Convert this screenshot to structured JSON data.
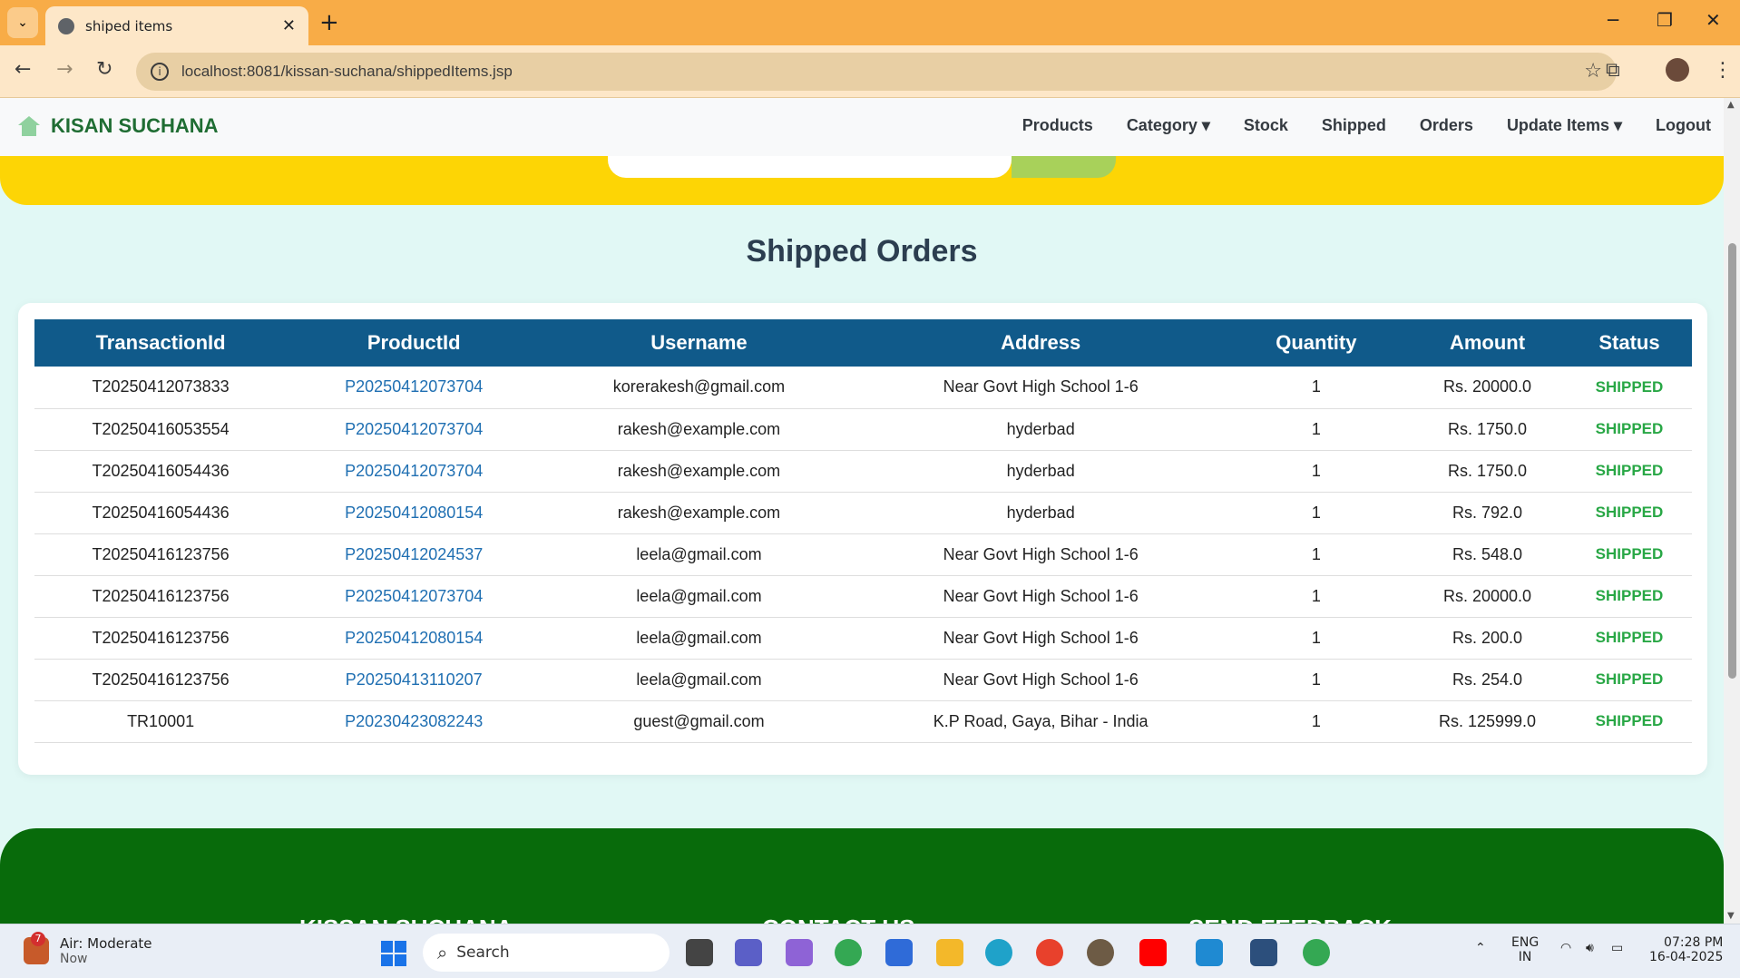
{
  "browser": {
    "tab_title": "shiped items",
    "url": "localhost:8081/kissan-suchana/shippedItems.jsp"
  },
  "navbar": {
    "brand": "KISAN SUCHANA",
    "links": [
      "Products",
      "Category ▾",
      "Stock",
      "Shipped",
      "Orders",
      "Update Items ▾",
      "Logout"
    ]
  },
  "page": {
    "heading": "Shipped Orders"
  },
  "table": {
    "columns": [
      "TransactionId",
      "ProductId",
      "Username",
      "Address",
      "Quantity",
      "Amount",
      "Status"
    ],
    "rows": [
      [
        "T20250412073833",
        "P20250412073704",
        "korerakesh@gmail.com",
        "Near Govt High School 1-6",
        "1",
        "Rs. 20000.0",
        "SHIPPED"
      ],
      [
        "T20250416053554",
        "P20250412073704",
        "rakesh@example.com",
        "hyderbad",
        "1",
        "Rs. 1750.0",
        "SHIPPED"
      ],
      [
        "T20250416054436",
        "P20250412073704",
        "rakesh@example.com",
        "hyderbad",
        "1",
        "Rs. 1750.0",
        "SHIPPED"
      ],
      [
        "T20250416054436",
        "P20250412080154",
        "rakesh@example.com",
        "hyderbad",
        "1",
        "Rs. 792.0",
        "SHIPPED"
      ],
      [
        "T20250416123756",
        "P20250412024537",
        "leela@gmail.com",
        "Near Govt High School 1-6",
        "1",
        "Rs. 548.0",
        "SHIPPED"
      ],
      [
        "T20250416123756",
        "P20250412073704",
        "leela@gmail.com",
        "Near Govt High School 1-6",
        "1",
        "Rs. 20000.0",
        "SHIPPED"
      ],
      [
        "T20250416123756",
        "P20250412080154",
        "leela@gmail.com",
        "Near Govt High School 1-6",
        "1",
        "Rs. 200.0",
        "SHIPPED"
      ],
      [
        "T20250416123756",
        "P20250413110207",
        "leela@gmail.com",
        "Near Govt High School 1-6",
        "1",
        "Rs. 254.0",
        "SHIPPED"
      ],
      [
        "TR10001",
        "P20230423082243",
        "guest@gmail.com",
        "K.P Road, Gaya, Bihar - India",
        "1",
        "Rs. 125999.0",
        "SHIPPED"
      ]
    ]
  },
  "footer": {
    "headings": [
      "KISSAN SUCHANA",
      "CONTACT US",
      "SEND FEEDBACK"
    ]
  },
  "taskbar": {
    "weather_badge": "7",
    "weather_title": "Air: Moderate",
    "weather_sub": "Now",
    "search": "Search",
    "lang1": "ENG",
    "lang2": "IN",
    "time": "07:28 PM",
    "date": "16-04-2025"
  },
  "colors": {
    "brand_green": "#1f6d33",
    "table_header": "#105a8a",
    "status_green": "#28a745",
    "banner_yellow": "#fdd505",
    "footer_green": "#086b0b"
  }
}
